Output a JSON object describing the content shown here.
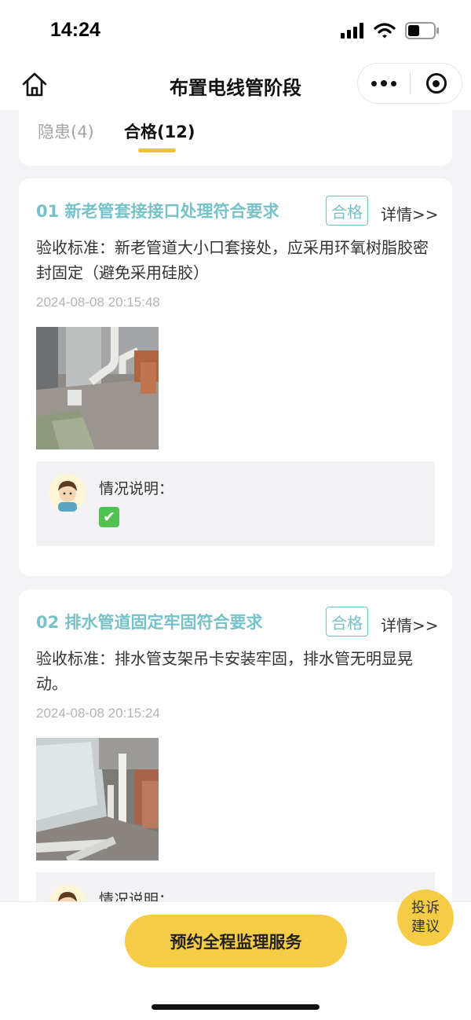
{
  "status_bar": {
    "time": "14:24"
  },
  "nav": {
    "title": "布置电线管阶段"
  },
  "tabs": [
    {
      "label": "隐患(4)",
      "active": false
    },
    {
      "label": "合格(12)",
      "active": true
    }
  ],
  "items": [
    {
      "title": "01 新老管套接接口处理符合要求",
      "badge": "合格",
      "details": "详情>>",
      "standard": "验收标准：新老管道大小口套接处，应采用环氧树脂胶密封固定（避免采用硅胶）",
      "timestamp": "2024-08-08 20:15:48",
      "note_label": "情况说明：",
      "note_value": "✔"
    },
    {
      "title": "02 排水管道固定牢固符合要求",
      "badge": "合格",
      "details": "详情>>",
      "standard": "验收标准：排水管支架吊卡安装牢固，排水管无明显晃动。",
      "timestamp": "2024-08-08 20:15:24",
      "note_label": "情况说明："
    }
  ],
  "bottom": {
    "book_label": "预约全程监理服务",
    "complaint_line1": "投诉",
    "complaint_line2": "建议"
  },
  "colors": {
    "accent_teal": "#77c2c9",
    "accent_yellow": "#f5cc45",
    "tab_underline": "#e8c440"
  }
}
